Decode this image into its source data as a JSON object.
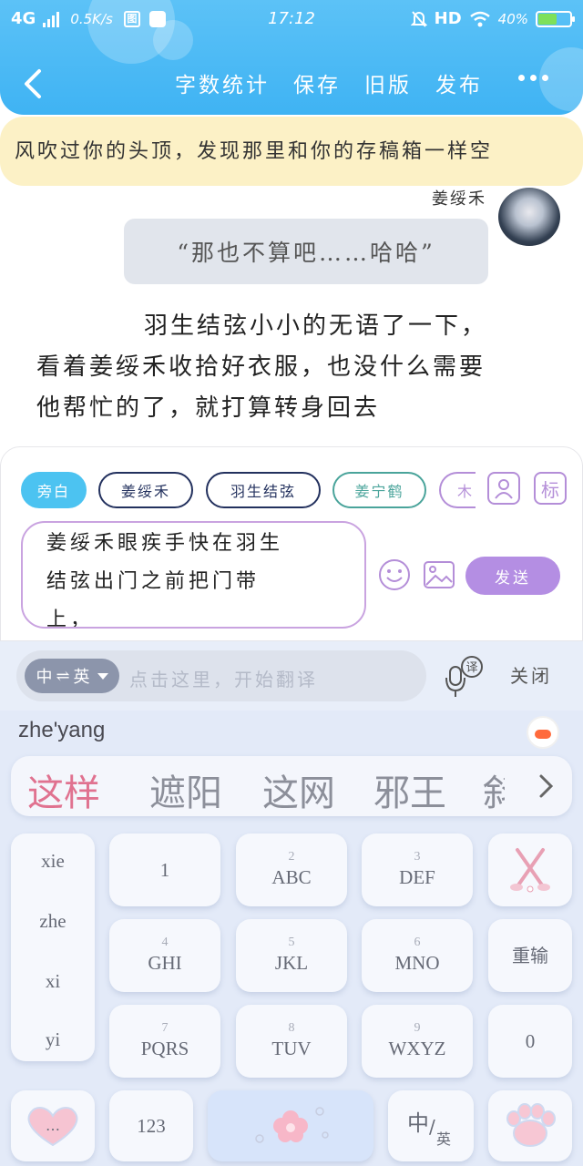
{
  "status_bar": {
    "network": "4G",
    "speed": "0.5K/s",
    "sq_icon": "图",
    "time": "17:12",
    "hd": "HD",
    "battery": "40%"
  },
  "toolbar": {
    "word_count": "字数统计",
    "save": "保存",
    "old_version": "旧版",
    "publish": "发布"
  },
  "banner": {
    "text": "风吹过你的头顶，发现那里和你的存稿箱一样空"
  },
  "chat": {
    "speaker": "姜绥禾",
    "bubble": "“那也不算吧……哈哈”",
    "narrative_line1": "羽生结弦小小的无语了一下，",
    "narrative_line2": "看着姜绥禾收拾好衣服，也没什么需要",
    "narrative_line3": "他帮忙的了，就打算转身回去"
  },
  "composer": {
    "chips": [
      "旁白",
      "姜绥禾",
      "羽生结弦",
      "姜宁鹤",
      "木"
    ],
    "tag_button": "标",
    "input_line1": "姜绥禾眼疾手快在羽生",
    "input_line2": "结弦出门之前把门带",
    "input_line3": "上，",
    "send": "发送"
  },
  "keyboard": {
    "lang_toggle_left": "中",
    "lang_toggle_swap": "⇌",
    "lang_toggle_right": "英",
    "translate_placeholder": "点击这里，开始翻译",
    "mic_badge": "译",
    "close": "关闭",
    "pinyin": "zhe'yang",
    "candidates": [
      "这样",
      "遮阳",
      "这网",
      "邪王",
      "斜"
    ],
    "side_candidates": [
      "xie",
      "zhe",
      "xi",
      "yi"
    ],
    "keys": [
      {
        "sub": "",
        "main": "1"
      },
      {
        "sub": "2",
        "main": "ABC"
      },
      {
        "sub": "3",
        "main": "DEF"
      },
      {
        "sub": "4",
        "main": "GHI"
      },
      {
        "sub": "5",
        "main": "JKL"
      },
      {
        "sub": "6",
        "main": "MNO"
      },
      {
        "sub": "7",
        "main": "PQRS"
      },
      {
        "sub": "8",
        "main": "TUV"
      },
      {
        "sub": "9",
        "main": "WXYZ"
      }
    ],
    "reenter": "重输",
    "zero": "0",
    "more": "…",
    "num": "123",
    "zh": "中",
    "slash": "/",
    "en": "英"
  },
  "colors": {
    "header": "#3fb3f3",
    "banner": "#fcf1c6",
    "accent_purple": "#b48ee3",
    "candidate_highlight": "#e07290"
  },
  "icons": [
    "back-arrow-icon",
    "more-dots-icon",
    "person-icon",
    "emoji-icon",
    "image-icon",
    "microphone-icon",
    "chevron-right-icon",
    "golf-clubs-icon",
    "heart-icon",
    "cat-paw-icon",
    "flower-icon"
  ]
}
